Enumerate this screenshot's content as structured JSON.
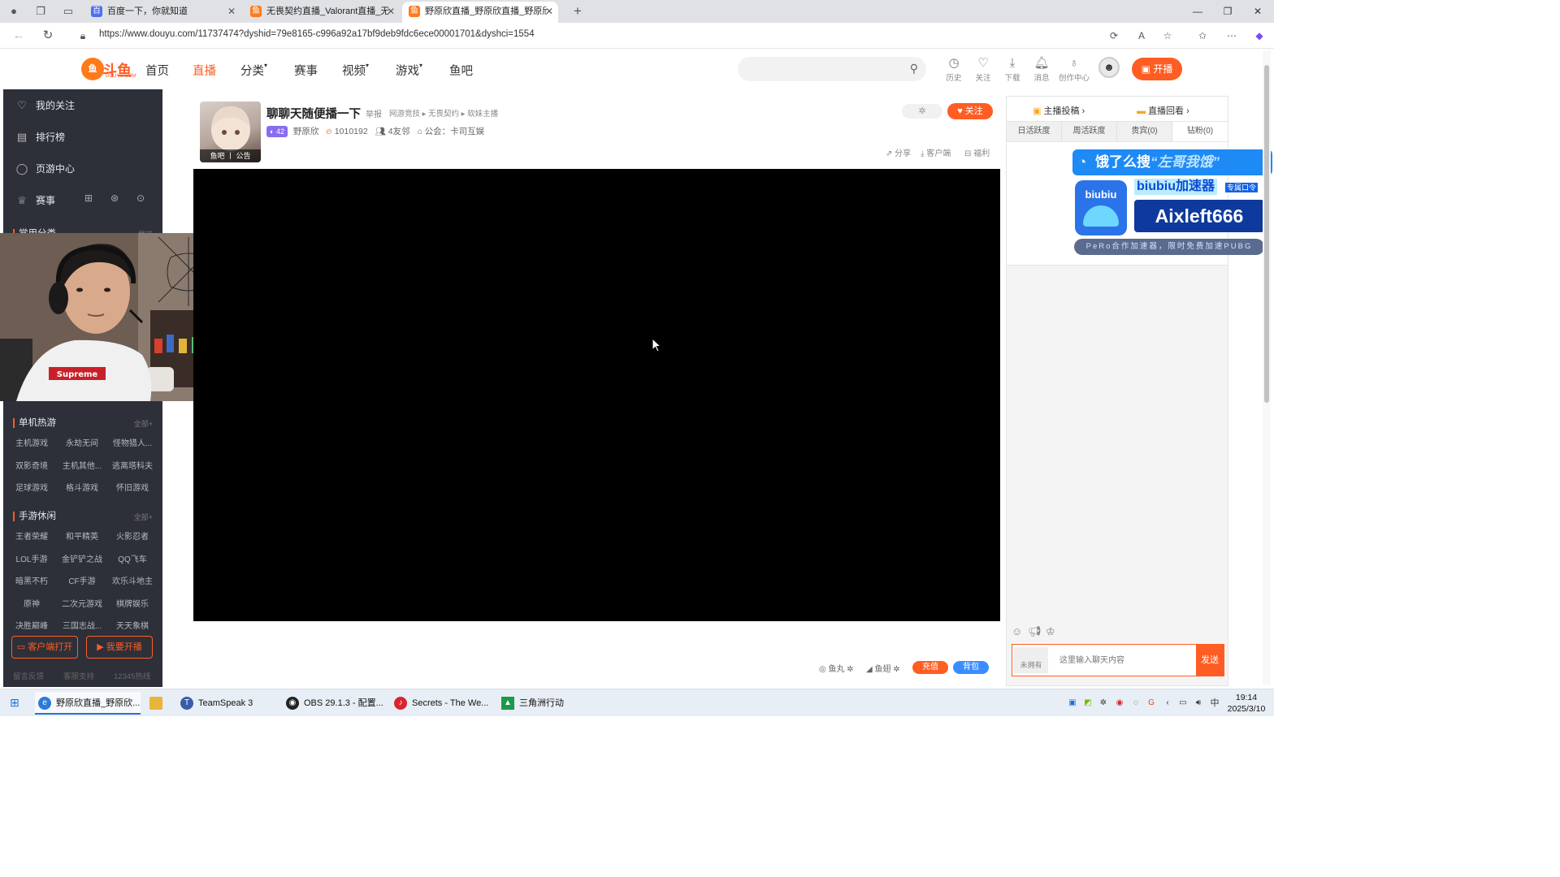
{
  "browser": {
    "tabs": [
      {
        "title": "百度一下，你就知道",
        "fav": "百"
      },
      {
        "title": "无畏契约直播_Valorant直播_无畏",
        "fav": "鱼"
      },
      {
        "title": "野原欣直播_野原欣直播_野原欣无",
        "fav": "鱼"
      }
    ],
    "new_tab": "+",
    "url": "https://www.douyu.com/11737474?dyshid=79e8165-c996a92a17bf9deb9fdc6ece00001701&dyshci=1554"
  },
  "site": {
    "logo_text": "斗鱼",
    "logo_sub": "DOUYU.COM",
    "nav": [
      {
        "label": "首页"
      },
      {
        "label": "直播",
        "active": true
      },
      {
        "label": "分类",
        "caret": true
      },
      {
        "label": "赛事"
      },
      {
        "label": "视频",
        "caret": true
      },
      {
        "label": "游戏",
        "caret": true
      },
      {
        "label": "鱼吧"
      }
    ],
    "header_icons": [
      {
        "label": "历史",
        "icon": "clock-icon"
      },
      {
        "label": "关注",
        "icon": "heart-icon"
      },
      {
        "label": "下载",
        "icon": "download-icon"
      },
      {
        "label": "消息",
        "icon": "bell-icon"
      },
      {
        "label": "创作中心",
        "icon": "bulb-icon"
      }
    ],
    "kaibo_label": "开播"
  },
  "sidebar": {
    "main_items": [
      {
        "label": "我的关注",
        "icon": "heart-icon"
      },
      {
        "label": "排行榜",
        "icon": "rank-icon"
      },
      {
        "label": "页游中心",
        "icon": "gamepad-icon"
      },
      {
        "label": "赛事",
        "icon": "trophy-icon"
      }
    ],
    "partial_section": "常用分类",
    "partial_more": "展开",
    "sections": [
      {
        "title": "单机热游",
        "more": "全部+",
        "items": [
          "主机游戏",
          "永劫无间",
          "怪物猎人...",
          "双影奇境",
          "主机其他...",
          "逃离塔科夫",
          "足球游戏",
          "格斗游戏",
          "怀旧游戏"
        ]
      },
      {
        "title": "手游休闲",
        "more": "全部+",
        "items": [
          "王者荣耀",
          "和平精英",
          "火影忍者",
          "LOL手游",
          "金铲铲之战",
          "QQ飞车",
          "暗黑不朽",
          "CF手游",
          "欢乐斗地主",
          "原神",
          "二次元游戏",
          "棋牌娱乐",
          "决胜巅峰",
          "三国志战...",
          "天天象棋"
        ]
      }
    ],
    "btn_client": "客户端打开",
    "btn_stream": "我要开播",
    "footer": [
      "留言反馈",
      "客服支持",
      "12345热线"
    ]
  },
  "room": {
    "title": "聊聊天随便播一下",
    "report": "举报",
    "breadcrumb": "网游竞技 ▸ 无畏契约 ▸ 软妹主播",
    "level": "42",
    "streamer": "野原欣",
    "heat": "1010192",
    "friends": "4友邻",
    "guild": "公会：卡司互娱",
    "cover_tabs": "鱼吧 丨 公告",
    "follow_label": "关注",
    "actions": [
      "分享",
      "客户端",
      "福利"
    ]
  },
  "gift_bar": {
    "items": [
      "鱼丸",
      "鱼翅"
    ],
    "recharge": "充值",
    "backpack": "背包"
  },
  "right_panel": {
    "top_links": [
      "主播投稿 ›",
      "直播回看 ›"
    ],
    "rank_tabs": [
      {
        "label": "日活跃度",
        "active": false
      },
      {
        "label": "周活跃度",
        "active": false
      },
      {
        "label": "贵宾(0)",
        "active": false
      },
      {
        "label": "钻粉(0)",
        "active": true
      }
    ],
    "chat_placeholder": "这里输入聊天内容",
    "no_badge": "未拥有",
    "send": "发送"
  },
  "ad": {
    "search_text": "饿了么搜",
    "search_query": "“左哥我饿”",
    "mascot": "biubiu",
    "title": "biubiu加速器",
    "tag": "专属口令",
    "code": "Aixleft666",
    "footer": "PeRo合作加速器，限时免费加速PUBG"
  },
  "taskbar": {
    "items": [
      {
        "label": "野原欣直播_野原欣...",
        "color": "#2b7bd6",
        "active": true
      },
      {
        "label": "",
        "color": "#e8b43a",
        "active": false
      },
      {
        "label": "TeamSpeak 3",
        "color": "#3d5ca8",
        "active": false
      },
      {
        "label": "OBS 29.1.3 - 配置...",
        "color": "#222222",
        "active": false
      },
      {
        "label": "Secrets - The We...",
        "color": "#d8262f",
        "active": false
      },
      {
        "label": "三角洲行动",
        "color": "#1a9a4a",
        "active": false
      }
    ],
    "ime": "中",
    "time": "19:14",
    "date": "2025/3/10"
  }
}
